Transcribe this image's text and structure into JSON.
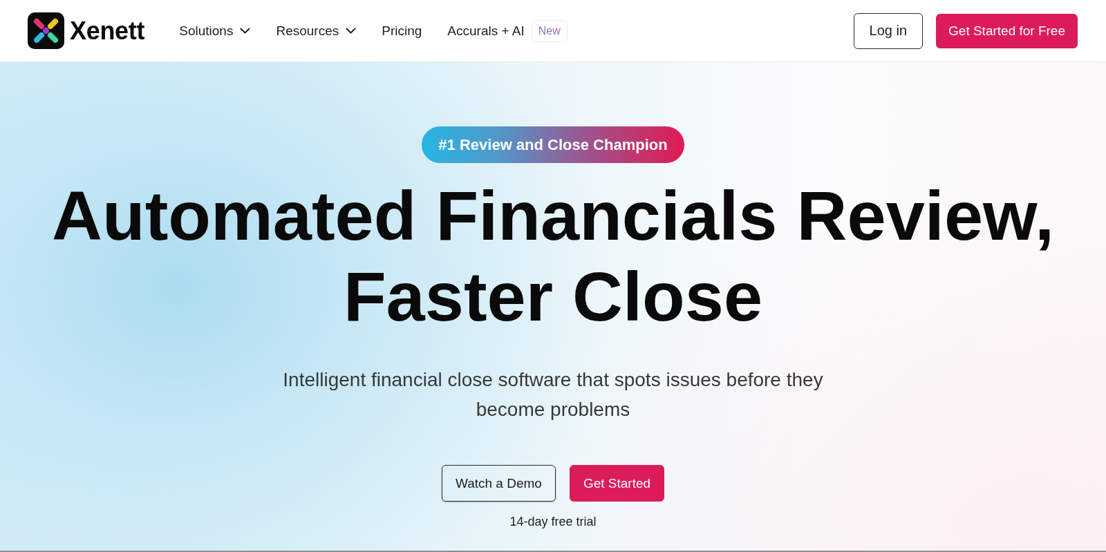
{
  "header": {
    "logo": {
      "name": "Xenett"
    },
    "nav": [
      {
        "label": "Solutions",
        "kind": "dropdown"
      },
      {
        "label": "Resources",
        "kind": "dropdown"
      },
      {
        "label": "Pricing",
        "kind": "link"
      },
      {
        "label": "Accurals + AI",
        "kind": "link",
        "badge": "New"
      }
    ],
    "actions": [
      {
        "label": "Log in",
        "kind": "outline"
      },
      {
        "label": "Get Started for Free",
        "kind": "primary"
      }
    ]
  },
  "hero": {
    "badge": "#1 Review and Close Champion",
    "title": "Automated Financials Review, Faster Close",
    "subtitle": "Intelligent financial close software that spots issues before they become problems",
    "buttons": [
      {
        "label": "Watch a Demo",
        "kind": "outline"
      },
      {
        "label": "Get Started",
        "kind": "primary"
      }
    ],
    "note": "14-day free trial"
  }
}
